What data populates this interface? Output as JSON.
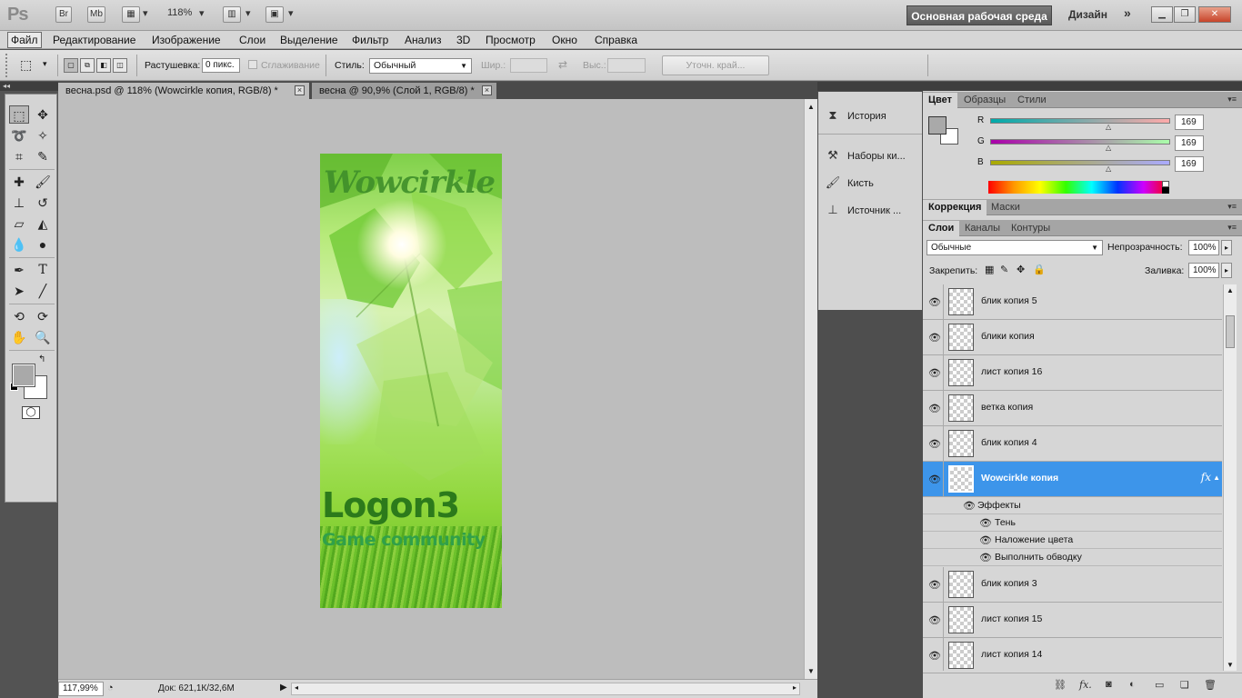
{
  "app": {
    "logo": "Ps",
    "bridge": "Br",
    "minibridge": "Mb",
    "zoom": "118%",
    "workspace": "Основная рабочая среда",
    "design": "Дизайн",
    "more": "»"
  },
  "menu": [
    "Файл",
    "Редактирование",
    "Изображение",
    "Слои",
    "Выделение",
    "Фильтр",
    "Анализ",
    "3D",
    "Просмотр",
    "Окно",
    "Справка"
  ],
  "options": {
    "feather_label": "Растушевка:",
    "feather_value": "0 пикс.",
    "antialias_label": "Сглаживание",
    "style_label": "Стиль:",
    "style_value": "Обычный",
    "width_label": "Шир.:",
    "height_label": "Выс.:",
    "refine_edge": "Уточн. край..."
  },
  "tabs": [
    {
      "title": "весна.psd @ 118% (Wowcirkle копия, RGB/8) *",
      "active": true
    },
    {
      "title": "весна @ 90,9% (Слой 1, RGB/8) *",
      "active": false
    }
  ],
  "artwork": {
    "title": "Wowcirkle",
    "logo": "Logon3",
    "subtitle": "Game community"
  },
  "status": {
    "zoom": "117,99%",
    "doc": "Док: 621,1К/32,6М"
  },
  "mini_panels": [
    "История",
    "Наборы ки...",
    "Кисть",
    "Источник ..."
  ],
  "color_panel": {
    "tabs": [
      "Цвет",
      "Образцы",
      "Стили"
    ],
    "channels": [
      {
        "name": "R",
        "value": "169"
      },
      {
        "name": "G",
        "value": "169"
      },
      {
        "name": "B",
        "value": "169"
      }
    ]
  },
  "adjust_tabs": [
    "Коррекция",
    "Маски"
  ],
  "layers_panel": {
    "tabs": [
      "Слои",
      "Каналы",
      "Контуры"
    ],
    "blend_mode": "Обычные",
    "opacity_label": "Непрозрачность:",
    "opacity": "100%",
    "lock_label": "Закрепить:",
    "fill_label": "Заливка:",
    "fill": "100%",
    "layers": [
      {
        "name": "блик копия 5"
      },
      {
        "name": "блики копия"
      },
      {
        "name": "лист копия 16"
      },
      {
        "name": "ветка копия"
      },
      {
        "name": "блик копия 4"
      },
      {
        "name": "Wowcirkle копия",
        "selected": true,
        "fx": "fx"
      },
      {
        "name": "блик копия 3"
      },
      {
        "name": "лист копия 15"
      },
      {
        "name": "лист копия 14"
      }
    ],
    "effects_header": "Эффекты",
    "effects": [
      "Тень",
      "Наложение цвета",
      "Выполнить обводку"
    ]
  },
  "colors": {
    "selection_blue": "#3d95ea",
    "foreground": "#a9a9a9",
    "background": "#ffffff"
  }
}
